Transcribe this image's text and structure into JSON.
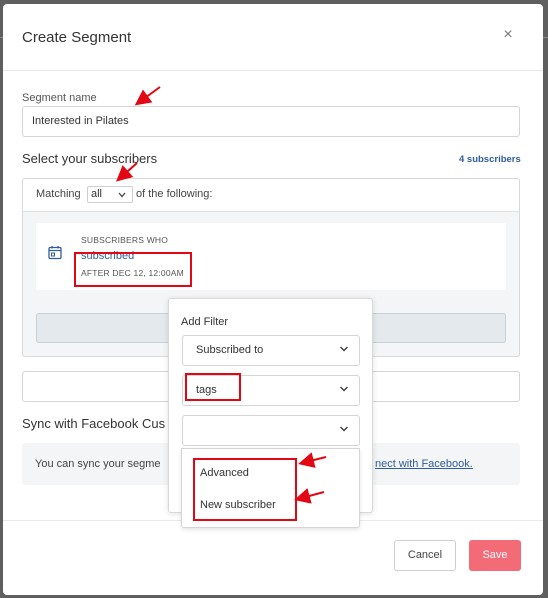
{
  "modal": {
    "title": "Create Segment",
    "close_symbol": "×"
  },
  "segment_name": {
    "label": "Segment name",
    "value": "Interested in Pilates"
  },
  "subscribers": {
    "title": "Select your subscribers",
    "count_link": "4 subscribers",
    "matching_prefix": "Matching",
    "matching_value": "all",
    "matching_suffix": "of the following:"
  },
  "rule": {
    "caption": "SUBSCRIBERS WHO",
    "action": "subscribed",
    "condition": "AFTER DEC 12, 12:00AM"
  },
  "facebook": {
    "title": "Sync with Facebook Cus",
    "text_left": "You can sync your segme",
    "link_right": "nect with Facebook."
  },
  "add_filter": {
    "title": "Add Filter",
    "type_select": "Subscribed to",
    "field_select": "tags",
    "value_select": "",
    "options": [
      "Advanced",
      "New subscriber"
    ]
  },
  "footer": {
    "cancel_label": "Cancel",
    "save_label": "Save"
  },
  "colors": {
    "accent": "#f26b77",
    "link": "#2f5d9d",
    "annotation_red": "#e30613"
  },
  "icons": {
    "close": "close-icon",
    "calendar": "calendar-icon",
    "chevron": "chevron-down-icon",
    "annotation": "arrow-annotation"
  }
}
